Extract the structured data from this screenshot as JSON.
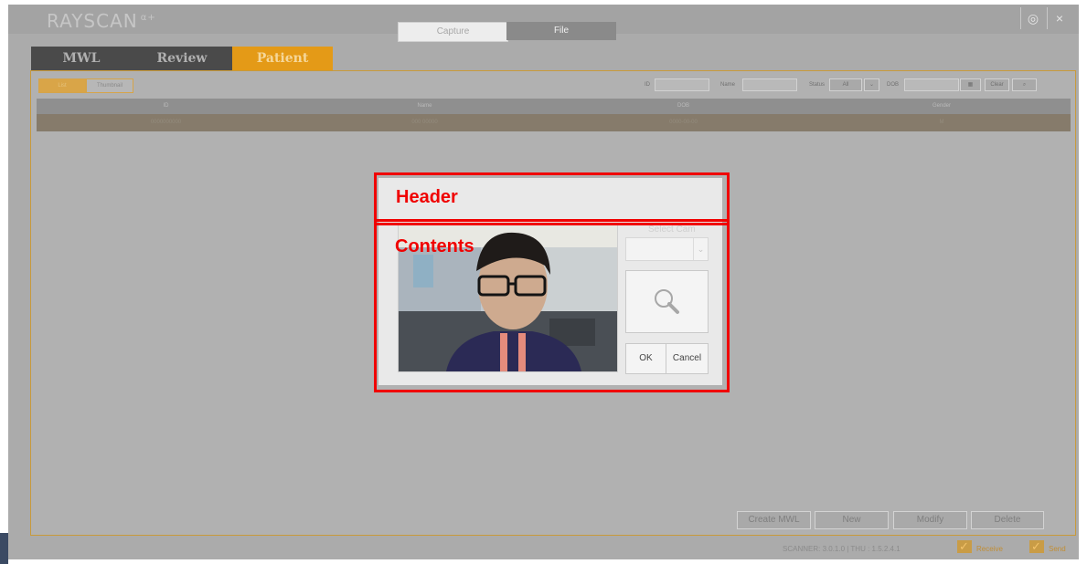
{
  "app": {
    "logo": "RAYSCAN",
    "logo_sup": "α+"
  },
  "window_controls": {
    "settings_icon": "◎",
    "close_icon": "×"
  },
  "tabs": [
    {
      "label": "MWL"
    },
    {
      "label": "Review"
    },
    {
      "label": "Patient"
    }
  ],
  "active_tab": "Patient",
  "toolbar": {
    "view_buttons": [
      {
        "label": "List"
      },
      {
        "label": "Thumbnail"
      }
    ],
    "filters": {
      "id_label": "ID",
      "name_label": "Name",
      "status_label": "Status",
      "status_value": "All",
      "dob_label": "DOB",
      "clear_label": "Clear",
      "search_icon": "search-icon"
    }
  },
  "grid": {
    "columns": [
      "ID",
      "Name",
      "DOB",
      "Gender"
    ],
    "rows": [
      [
        "0000000000",
        "000 00000",
        "0000-00-00",
        "M"
      ]
    ]
  },
  "bottom_buttons": [
    "Create MWL",
    "New",
    "Modify",
    "Delete"
  ],
  "status_bar": {
    "scanner_text": "SCANNER: 3.0.1.0 | THU : 1.5.2.4.1",
    "receive_label": "Receive",
    "send_label": "Send",
    "receive_checked": true,
    "send_checked": true
  },
  "dialog": {
    "tabs": [
      {
        "label": "Capture"
      },
      {
        "label": "File"
      }
    ],
    "active_tab": "File",
    "select_cam_label": "Select Cam",
    "select_value": "",
    "ok_label": "OK",
    "cancel_label": "Cancel"
  },
  "annotations": {
    "header": "Header",
    "contents": "Contents",
    "color": "#f00000"
  }
}
